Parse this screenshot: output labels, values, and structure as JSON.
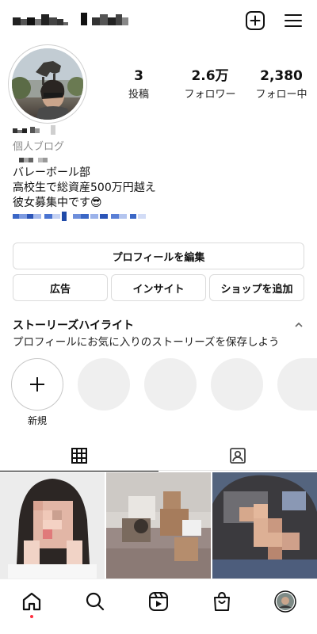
{
  "header": {
    "username_pixelated": true,
    "new_post_icon": "plus-square-icon",
    "menu_icon": "hamburger-menu-icon"
  },
  "profile": {
    "stats": [
      {
        "value": "3",
        "label": "投稿"
      },
      {
        "value": "2.6万",
        "label": "フォロワー"
      },
      {
        "value": "2,380",
        "label": "フォロー中"
      }
    ],
    "category": "個人ブログ",
    "bio_lines": [
      "バレーボール部",
      "高校生で総資産500万円越え",
      "彼女募集中です"
    ],
    "bio_emoji": "😎"
  },
  "actions": {
    "edit_profile": "プロフィールを編集",
    "ads": "広告",
    "insights": "インサイト",
    "add_shop": "ショップを追加"
  },
  "highlights": {
    "title": "ストーリーズハイライト",
    "subtitle": "プロフィールにお気に入りのストーリーズを保存しよう",
    "new_label": "新規"
  },
  "tabs": [
    {
      "icon": "grid-icon",
      "active": true
    },
    {
      "icon": "tagged-person-icon",
      "active": false
    }
  ],
  "bottom_nav": [
    {
      "icon": "home-icon",
      "active": true,
      "notification_dot": true
    },
    {
      "icon": "search-icon"
    },
    {
      "icon": "reels-icon"
    },
    {
      "icon": "shop-bag-icon"
    },
    {
      "icon": "profile-avatar-icon"
    }
  ],
  "colors": {
    "border": "#dbdbdb",
    "muted_text": "#8e8e8e",
    "highlight_placeholder": "#efefef",
    "notification": "#ff3040",
    "link_pixel_blue": "#3b67c6"
  }
}
